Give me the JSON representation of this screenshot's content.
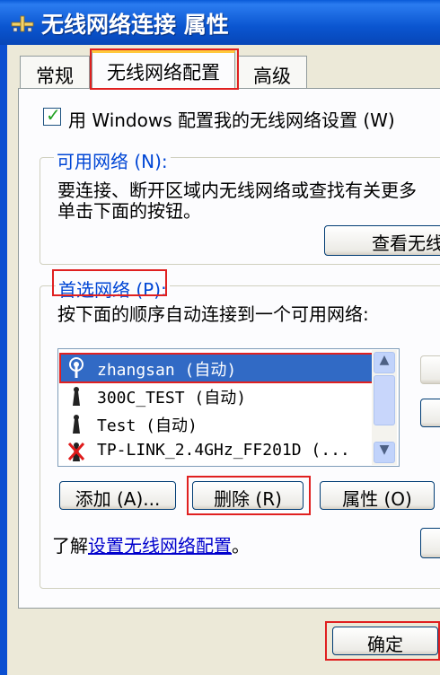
{
  "window": {
    "title": "无线网络连接 属性",
    "icon": "network-connection-icon"
  },
  "tabs": [
    {
      "label": "常规"
    },
    {
      "label": "无线网络配置"
    },
    {
      "label": "高级"
    }
  ],
  "config": {
    "use_windows_label": "用 Windows 配置我的无线网络设置 (W)",
    "use_windows_checked": true
  },
  "available": {
    "legend": "可用网络 (N):",
    "desc_line1": "要连接、断开区域内无线网络或查找有关更多",
    "desc_line2": "单击下面的按钮。",
    "view_button": "查看无线"
  },
  "preferred": {
    "legend": "首选网络 (P):",
    "desc": "按下面的顺序自动连接到一个可用网络:",
    "networks": [
      {
        "name": "zhangsan (自动)",
        "icon": "antenna-connected-icon",
        "selected": true
      },
      {
        "name": "300C_TEST (自动)",
        "icon": "antenna-icon",
        "selected": false
      },
      {
        "name": "Test (自动)",
        "icon": "antenna-icon",
        "selected": false
      },
      {
        "name": "TP-LINK_2.4GHz_FF201D (...",
        "icon": "antenna-unavailable-icon",
        "selected": false
      }
    ],
    "add_button": "添加 (A)...",
    "delete_button": "删除 (R)",
    "properties_button": "属性 (O)"
  },
  "learn_more": {
    "prefix": "了解",
    "link": "设置无线网络配置",
    "suffix": "。"
  },
  "footer": {
    "ok_button": "确定"
  },
  "colors": {
    "titlebar": "#0a55d0",
    "highlight_red": "#e02020",
    "selection": "#316ac5",
    "legend_blue": "#0046d5"
  }
}
